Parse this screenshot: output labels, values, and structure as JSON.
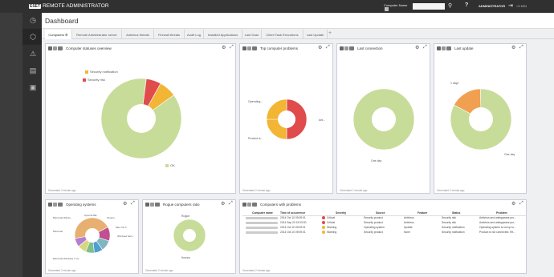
{
  "app": {
    "logo": "ESET",
    "title": "REMOTE ADMINISTRATOR",
    "search_select": "Computer Name",
    "user": "ADMINISTRATOR",
    "session": ">9 MIN"
  },
  "page": {
    "title": "Dashboard"
  },
  "tabs": [
    {
      "label": "Computers"
    },
    {
      "label": "Remote Administrator server"
    },
    {
      "label": "Antivirus threats"
    },
    {
      "label": "Firewall threats"
    },
    {
      "label": "Audit Log"
    },
    {
      "label": "Installed Applications"
    },
    {
      "label": "Last Scan"
    },
    {
      "label": "Client Task Executions"
    },
    {
      "label": "Last Update"
    }
  ],
  "panels": {
    "status": {
      "title": "Computer statuses overview",
      "generated": "Generated 2 minute ago",
      "legend": [
        {
          "label": "Security notification",
          "color": "#f2b534"
        },
        {
          "label": "Security risk",
          "color": "#e04b4b"
        },
        {
          "label": "OK",
          "color": "#c8dc9a"
        }
      ]
    },
    "problems_chart": {
      "title": "Top computer problems",
      "generated": "Generated 2 minute ago",
      "labels": [
        "Operating...",
        "Product is...",
        "Ant..."
      ]
    },
    "last_connection": {
      "title": "Last connection",
      "generated": "Generated 2 minute ago",
      "labels": [
        "One day"
      ]
    },
    "last_update": {
      "title": "Last update",
      "generated": "Generated 2 minute ago",
      "labels": [
        "1 days",
        "One day"
      ]
    },
    "os": {
      "title": "Operating systems",
      "generated": "Generated 2 minute ago",
      "labels": [
        "Microsoft Windo...",
        "OpenSUSE",
        "Ubuntu",
        "Mac OS X",
        "Microsoft",
        "Windows Serv...",
        "Microsoft Windows 7 ult..."
      ]
    },
    "rogue": {
      "title": "Rogue computers ratio",
      "generated": "Generated 2 minute ago",
      "labels": [
        "Rogue",
        "Known"
      ]
    },
    "table": {
      "title": "Computers with problems",
      "generated": "Generated 2 minute ago",
      "columns": [
        "Computer name",
        "Time of occurrence",
        "Severity",
        "Source",
        "Feature",
        "Status",
        "Problem"
      ],
      "rows": [
        {
          "time": "2014 Oct 10 09:09:01",
          "severity": "Critical",
          "sev_color": "#e04b4b",
          "source": "Security product",
          "feature": "Antivirus",
          "status": "Security risk",
          "problem": "Antivirus and antispyware pro..."
        },
        {
          "time": "2014 Sep 20 19:23:00",
          "severity": "Critical",
          "sev_color": "#e04b4b",
          "source": "Security product",
          "feature": "Antivirus",
          "status": "Security risk",
          "problem": "Antivirus and antispyware pro..."
        },
        {
          "time": "2014 Oct 10 09:09:01",
          "severity": "Warning",
          "sev_color": "#f2b534",
          "source": "Operating system",
          "feature": "Update",
          "status": "Security notification",
          "problem": "Operating system is not up to..."
        },
        {
          "time": "2014 Oct 10 09:09:01",
          "severity": "Warning",
          "sev_color": "#f2b534",
          "source": "Security product",
          "feature": "None",
          "status": "Security notification",
          "problem": "Product is not connected. Re..."
        }
      ]
    }
  },
  "chart_data": [
    {
      "type": "pie",
      "title": "Computer statuses overview",
      "categories": [
        "OK",
        "Security risk",
        "Security notification"
      ],
      "values": [
        87,
        6,
        7
      ],
      "colors": [
        "#c8dc9a",
        "#e04b4b",
        "#f2b534"
      ]
    },
    {
      "type": "pie",
      "title": "Top computer problems",
      "categories": [
        "Ant...",
        "Operating...",
        "Product is..."
      ],
      "values": [
        50,
        25,
        25
      ],
      "colors": [
        "#e04b4b",
        "#f2b534",
        "#f2b534"
      ]
    },
    {
      "type": "pie",
      "title": "Last connection",
      "categories": [
        "One day"
      ],
      "values": [
        100
      ],
      "colors": [
        "#c8dc9a"
      ]
    },
    {
      "type": "pie",
      "title": "Last update",
      "categories": [
        "1 days",
        "One day"
      ],
      "values": [
        17,
        83
      ],
      "colors": [
        "#f0a050",
        "#c8dc9a"
      ]
    },
    {
      "type": "pie",
      "title": "Operating systems",
      "categories": [
        "Microsoft Windows 7 ult...",
        "Microsoft Windo...",
        "OpenSUSE",
        "Ubuntu",
        "Mac OS X",
        "Microsoft",
        "Windows Serv..."
      ],
      "values": [
        45,
        13,
        10,
        8,
        8,
        8,
        8
      ],
      "colors": [
        "#e8b070",
        "#c05090",
        "#7fb6c0",
        "#4f9fd0",
        "#7fc08a",
        "#d7d77f",
        "#b37fd0"
      ]
    },
    {
      "type": "pie",
      "title": "Rogue computers ratio",
      "categories": [
        "Known",
        "Rogue"
      ],
      "values": [
        100,
        0
      ],
      "colors": [
        "#c8dc9a",
        "#e04b4b"
      ]
    }
  ]
}
